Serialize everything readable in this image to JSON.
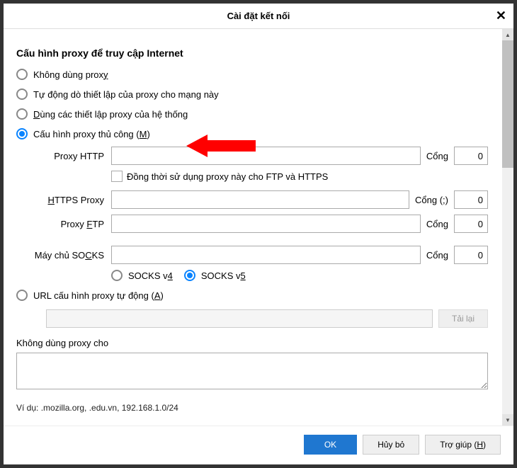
{
  "dialog": {
    "title": "Cài đặt kết nối"
  },
  "heading": "Cấu hình proxy để truy cập Internet",
  "radios": {
    "none": {
      "pre": "Không dùng prox",
      "ul": "y",
      "post": ""
    },
    "auto": {
      "pre": "Tự động dò thiết lập của proxy cho mạn",
      "ul": "g",
      "post": " này"
    },
    "system": {
      "pre": "",
      "ul": "D",
      "post": "ùng các thiết lập proxy của hệ thống"
    },
    "manual": {
      "pre": "Cấu hình proxy thủ công (",
      "ul": "M",
      "post": ")"
    },
    "pac": {
      "pre": "URL cấu hình proxy tự động (",
      "ul": "A",
      "post": ")"
    }
  },
  "labels": {
    "http": "Proxy HTTP",
    "https_pre": "",
    "https_ul": "H",
    "https_post": "TTPS Proxy",
    "ftp_pre": "Proxy ",
    "ftp_ul": "F",
    "ftp_post": "TP",
    "socks_pre": "Máy chủ SO",
    "socks_ul": "C",
    "socks_post": "KS",
    "port": "Cổng",
    "port_paren": "Cổng (;)",
    "also": "Đồng thời sử dụng proxy này cho FTP và HTTPS",
    "socks4_pre": "SOCKS v",
    "socks4_ul": "4",
    "socks5_pre": "SOCKS v",
    "socks5_ul": "5",
    "reload": "Tải lại",
    "noproxy": "Không dùng proxy cho",
    "example": "Ví dụ: .mozilla.org, .edu.vn, 192.168.1.0/24"
  },
  "values": {
    "http_port": "0",
    "https_port": "0",
    "ftp_port": "0",
    "socks_port": "0"
  },
  "buttons": {
    "ok": "OK",
    "cancel": "Hủy bỏ",
    "help_pre": "Trợ giúp (",
    "help_ul": "H",
    "help_post": ")"
  }
}
